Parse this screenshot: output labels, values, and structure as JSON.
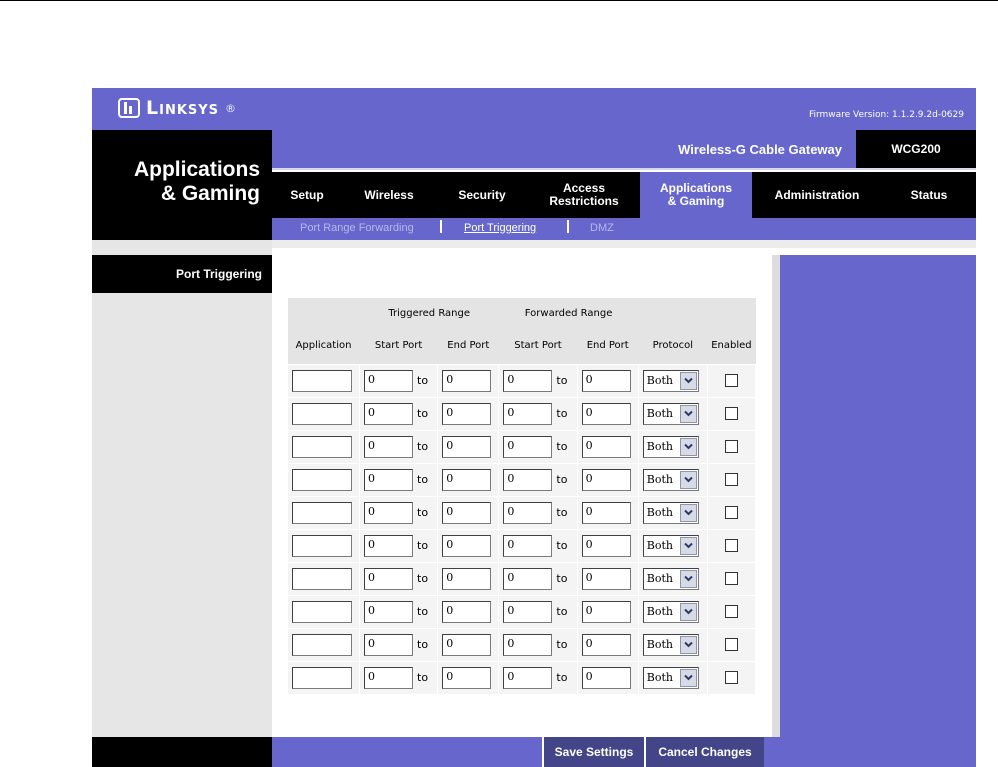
{
  "header": {
    "brand": "Linksys",
    "brand_mark": "®",
    "firmware": "Firmware Version: 1.1.2.9.2d-0629",
    "section_title": "Applications\n& Gaming",
    "product_name": "Wireless-G Cable Gateway",
    "model": "WCG200"
  },
  "nav": {
    "tabs": [
      {
        "label": "Setup"
      },
      {
        "label": "Wireless"
      },
      {
        "label": "Security"
      },
      {
        "label": "Access\nRestrictions"
      },
      {
        "label": "Applications\n& Gaming"
      },
      {
        "label": "Administration"
      },
      {
        "label": "Status"
      }
    ],
    "subtabs": [
      {
        "label": "Port Range Forwarding"
      },
      {
        "label": "Port Triggering"
      },
      {
        "label": "DMZ"
      }
    ]
  },
  "sidebar": {
    "label": "Port Triggering"
  },
  "table": {
    "group_headers": {
      "triggered": "Triggered Range",
      "forwarded": "Forwarded Range"
    },
    "columns": [
      "Application",
      "Start Port",
      "End Port",
      "Start Port",
      "End Port",
      "Protocol",
      "Enabled"
    ],
    "to_label": "to",
    "rows": [
      {
        "application": "",
        "trig_start": "0",
        "trig_end": "0",
        "fwd_start": "0",
        "fwd_end": "0",
        "protocol": "Both",
        "enabled": false
      },
      {
        "application": "",
        "trig_start": "0",
        "trig_end": "0",
        "fwd_start": "0",
        "fwd_end": "0",
        "protocol": "Both",
        "enabled": false
      },
      {
        "application": "",
        "trig_start": "0",
        "trig_end": "0",
        "fwd_start": "0",
        "fwd_end": "0",
        "protocol": "Both",
        "enabled": false
      },
      {
        "application": "",
        "trig_start": "0",
        "trig_end": "0",
        "fwd_start": "0",
        "fwd_end": "0",
        "protocol": "Both",
        "enabled": false
      },
      {
        "application": "",
        "trig_start": "0",
        "trig_end": "0",
        "fwd_start": "0",
        "fwd_end": "0",
        "protocol": "Both",
        "enabled": false
      },
      {
        "application": "",
        "trig_start": "0",
        "trig_end": "0",
        "fwd_start": "0",
        "fwd_end": "0",
        "protocol": "Both",
        "enabled": false
      },
      {
        "application": "",
        "trig_start": "0",
        "trig_end": "0",
        "fwd_start": "0",
        "fwd_end": "0",
        "protocol": "Both",
        "enabled": false
      },
      {
        "application": "",
        "trig_start": "0",
        "trig_end": "0",
        "fwd_start": "0",
        "fwd_end": "0",
        "protocol": "Both",
        "enabled": false
      },
      {
        "application": "",
        "trig_start": "0",
        "trig_end": "0",
        "fwd_start": "0",
        "fwd_end": "0",
        "protocol": "Both",
        "enabled": false
      },
      {
        "application": "",
        "trig_start": "0",
        "trig_end": "0",
        "fwd_start": "0",
        "fwd_end": "0",
        "protocol": "Both",
        "enabled": false
      }
    ]
  },
  "buttons": {
    "save": "Save Settings",
    "cancel": "Cancel Changes"
  },
  "colors": {
    "accent": "#6666cc",
    "dark": "#000000",
    "button": "#444488"
  },
  "icons": {
    "select_arrow": "chevron-down-icon",
    "logo": "linksys-logo-icon"
  }
}
